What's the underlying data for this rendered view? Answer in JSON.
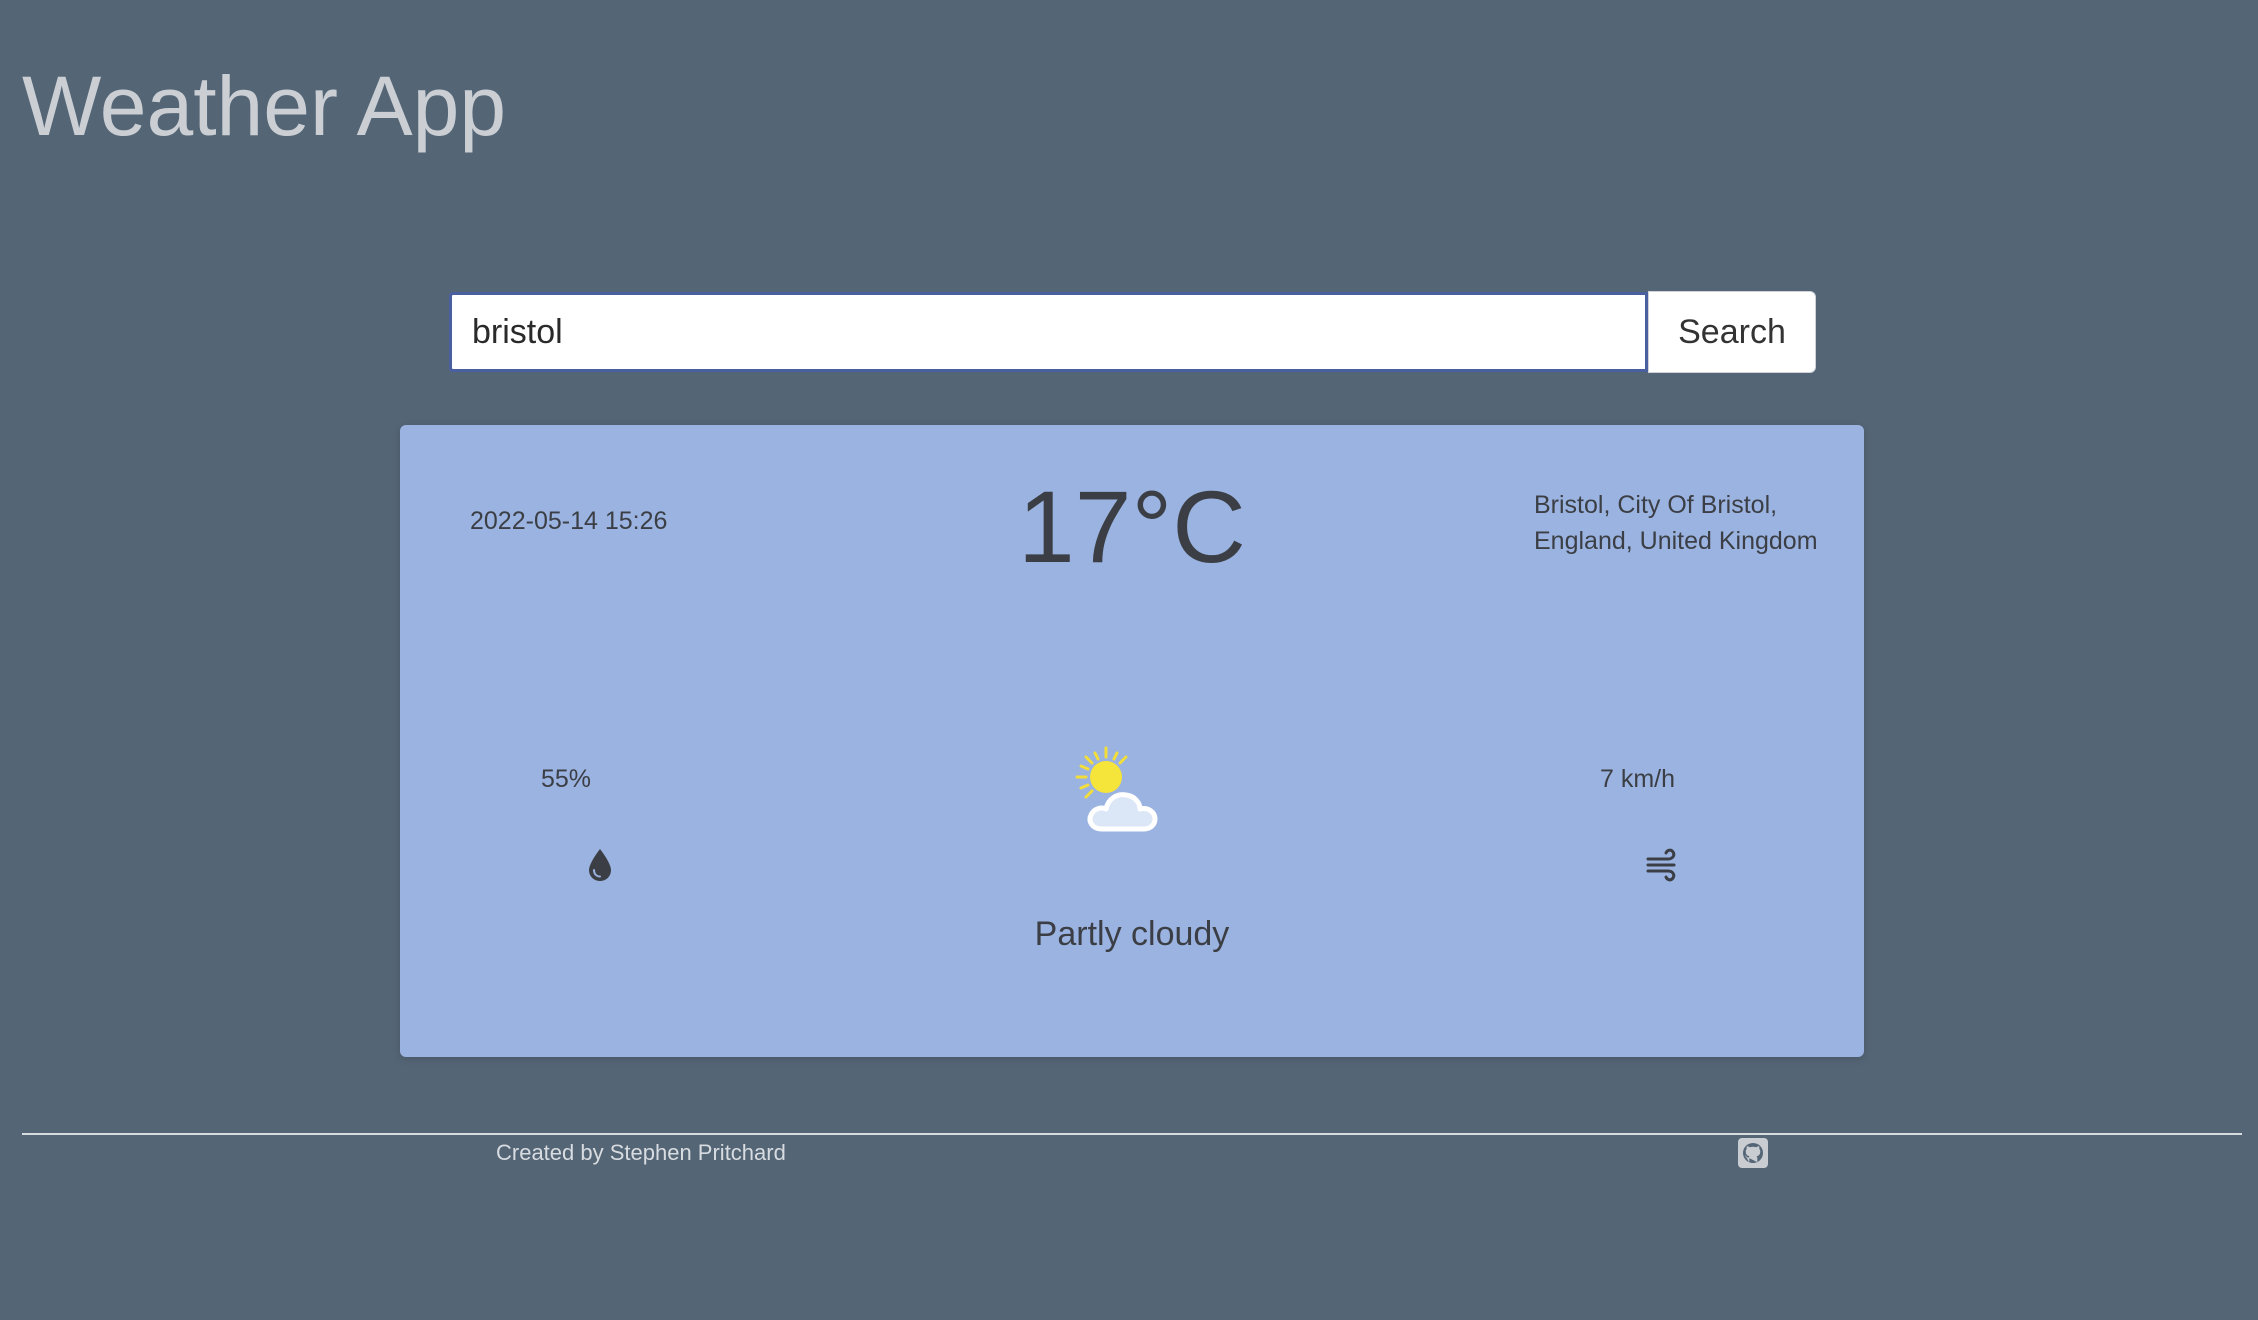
{
  "app": {
    "title": "Weather App"
  },
  "search": {
    "value": "bristol",
    "button_label": "Search"
  },
  "weather": {
    "datetime": "2022-05-14 15:26",
    "temperature": "17°C",
    "location_line1": "Bristol, City Of Bristol,",
    "location_line2": "England, United Kingdom",
    "humidity": "55%",
    "wind": "7 km/h",
    "condition": "Partly cloudy",
    "icons": {
      "humidity": "water-drop-icon",
      "condition": "partly-cloudy-icon",
      "wind": "wind-icon"
    }
  },
  "footer": {
    "credit": "Created by Stephen Pritchard",
    "link_icon": "github-icon"
  },
  "colors": {
    "background": "#546576",
    "card": "#9bb3e0",
    "title": "#cbcfd4",
    "text": "#3b3f45",
    "input_border": "#4a5fa0"
  }
}
